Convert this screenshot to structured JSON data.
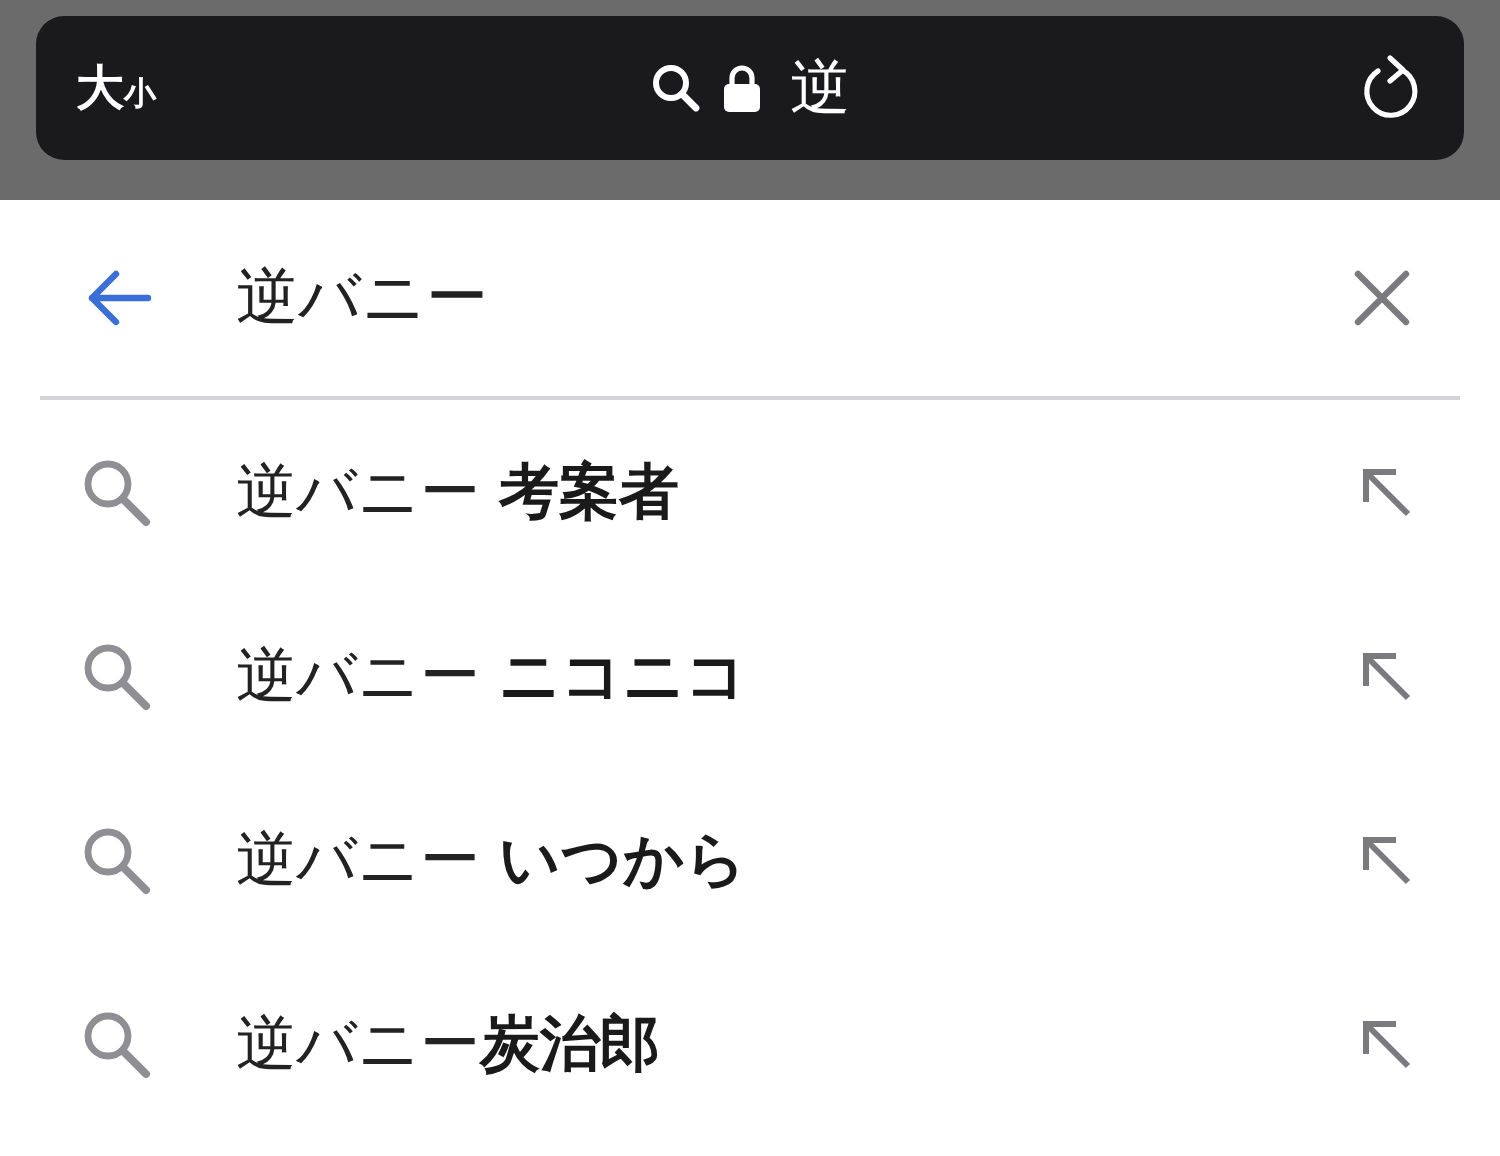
{
  "address_bar": {
    "text_size": {
      "big": "大",
      "small": "小"
    },
    "url": "逆"
  },
  "search": {
    "value": "逆バニー"
  },
  "suggestions": [
    {
      "text": "逆バニー **考案者**"
    },
    {
      "text": "逆バニー **ニコニコ**"
    },
    {
      "text": "逆バニー **いつから**"
    },
    {
      "text": "逆バニー**炭治郎**"
    }
  ]
}
